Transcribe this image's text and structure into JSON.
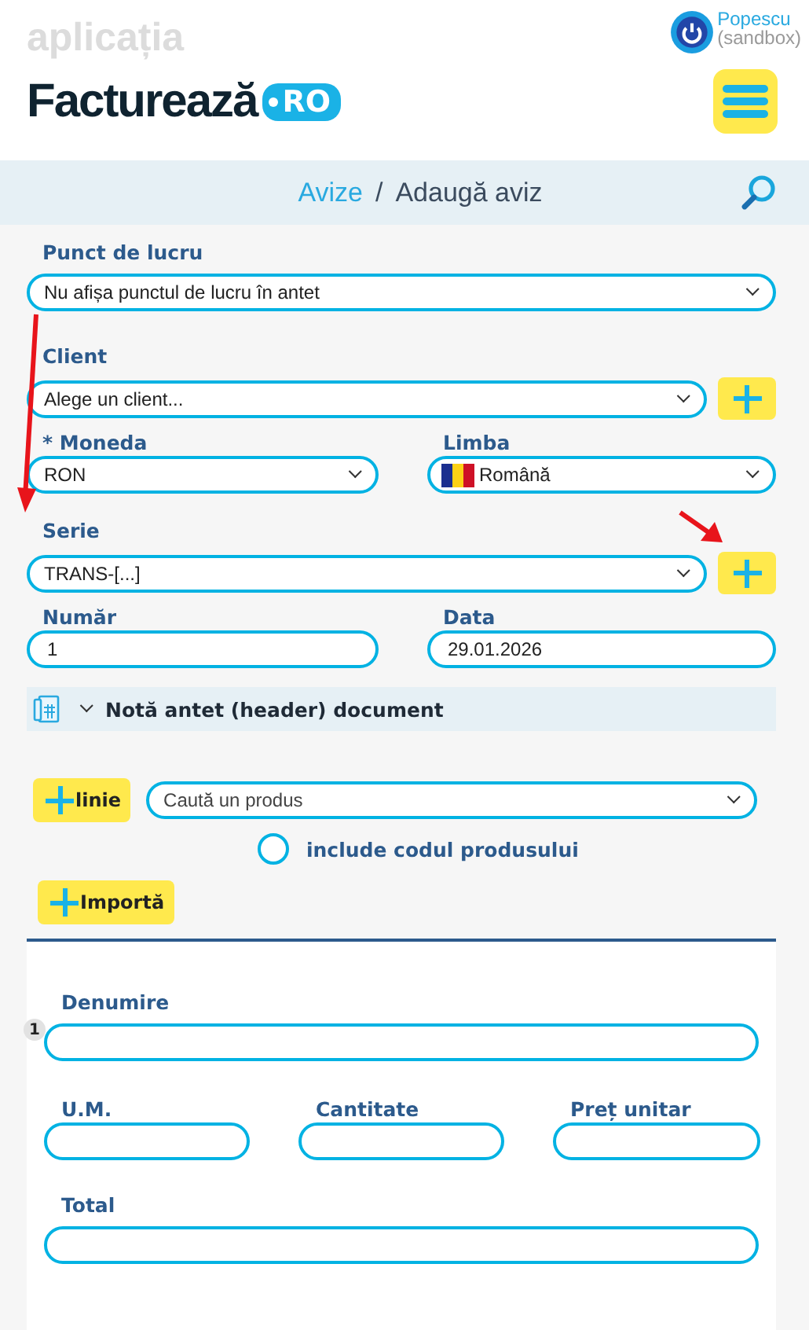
{
  "header": {
    "brand_top": "aplicația",
    "brand_name": "Facturează",
    "brand_suffix": "RO",
    "user_name": "Popescu",
    "user_env": "(sandbox)"
  },
  "breadcrumb": {
    "parent": "Avize",
    "separator": "/",
    "current": "Adaugă aviz"
  },
  "form": {
    "punct": {
      "label": "Punct de lucru",
      "value": "Nu afișa punctul de lucru în antet"
    },
    "client": {
      "label": "Client",
      "placeholder": "Alege un client..."
    },
    "moneda": {
      "label": "* Moneda",
      "value": "RON"
    },
    "limba": {
      "label": "Limba",
      "value": "Română"
    },
    "serie": {
      "label": "Serie",
      "value": "TRANS-[...]"
    },
    "numar": {
      "label": "Număr",
      "value": "1"
    },
    "data": {
      "label": "Data",
      "value": "29.01.2026"
    }
  },
  "header_note": {
    "label": "Notă antet (header) document",
    "expanded": false
  },
  "products": {
    "add_line_button": "linie",
    "search_placeholder": "Caută un produs",
    "include_code": {
      "label": "include codul produsului",
      "checked": false
    },
    "import_button": "Importă"
  },
  "line_item": {
    "index": "1",
    "name_label": "Denumire",
    "um_label": "U.M.",
    "qty_label": "Cantitate",
    "price_label": "Preț unitar",
    "total_label": "Total"
  }
}
